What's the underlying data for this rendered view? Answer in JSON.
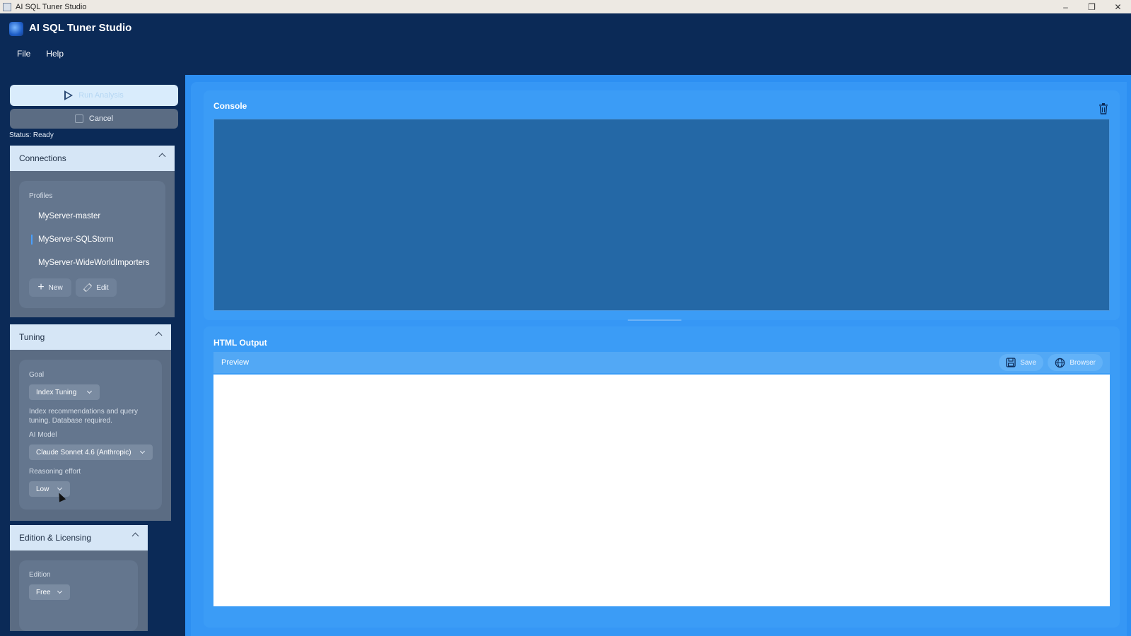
{
  "window": {
    "title": "AI SQL Tuner Studio"
  },
  "app": {
    "title": "AI SQL Tuner Studio"
  },
  "menu": {
    "file": "File",
    "help": "Help"
  },
  "actions": {
    "run": "Run Analysis",
    "cancel": "Cancel",
    "status": "Status: Ready"
  },
  "connections": {
    "header": "Connections",
    "profiles_label": "Profiles",
    "items": [
      {
        "label": "MyServer-master"
      },
      {
        "label": "MyServer-SQLStorm"
      },
      {
        "label": "MyServer-WideWorldImporters"
      }
    ],
    "selected": "MyServer-SQLStorm",
    "new_label": "New",
    "edit_label": "Edit"
  },
  "tuning": {
    "header": "Tuning",
    "goal_label": "Goal",
    "goal_value": "Index Tuning",
    "goal_desc_line1": "Index recommendations and query",
    "goal_desc_line2": "tuning. Database required.",
    "model_label": "AI Model",
    "model_value": "Claude Sonnet 4.6 (Anthropic)",
    "effort_label": "Reasoning effort",
    "effort_value": "Low"
  },
  "licensing": {
    "header": "Edition & Licensing",
    "edition_label": "Edition",
    "edition_value": "Free"
  },
  "console": {
    "title": "Console"
  },
  "output": {
    "title": "HTML Output",
    "preview_label": "Preview",
    "save_label": "Save",
    "browser_label": "Browser"
  },
  "colors": {
    "header_bg": "#0b2a57",
    "sidebar_panel": "#5b6c83",
    "main_bg": "#2d8ff2",
    "console_bg": "#2468a6",
    "accent": "#4aa0ff"
  }
}
